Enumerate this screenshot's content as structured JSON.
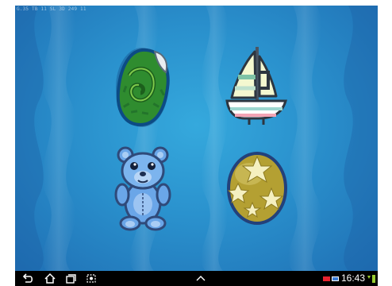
{
  "status_bar": {
    "debug_text": "G.35 TB 11 SL 3D 249 11"
  },
  "game": {
    "cards": [
      {
        "name": "shell"
      },
      {
        "name": "sailboat"
      },
      {
        "name": "teddy bear"
      },
      {
        "name": "ball with stars"
      }
    ]
  },
  "nav": {
    "back": "back-icon",
    "home": "home-icon",
    "recents": "recent-apps-icon",
    "screenshot": "screenshot-icon",
    "up": "chevron-up-icon",
    "clock": "16:43"
  },
  "colors": {
    "water": "#2a91cd",
    "navbar": "#000000"
  }
}
